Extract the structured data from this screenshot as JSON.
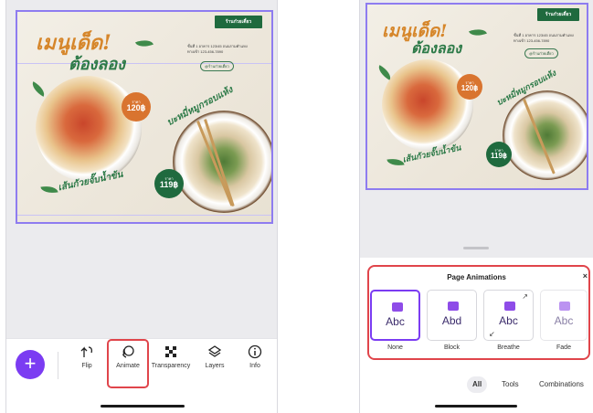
{
  "left_screen": {
    "design": {
      "brand": "ร้านก๋วยเตี๋ยว",
      "headline_line1": "เมนูเด็ด!",
      "headline_line2": "ต้องลอง",
      "info_line1": "ชั้นที่ 1 อาคาร 123/45 ถนนรามคำแหง",
      "info_line2": "ทางเข้า 123-456-7890",
      "info_pill": "@ร้านก๋วยเตี๋ยว",
      "price1_label": "ราคา",
      "price1": "120฿",
      "price2_label": "ราคา",
      "price2": "119฿",
      "caption_top": "บะหมี่หมูกรอบแห้ง",
      "caption_bottom": "เส้นกัวยจั๊บน้ำข้น"
    },
    "toolbar": {
      "add_label": "+",
      "tools": [
        {
          "label": "Flip",
          "icon": "flip-icon"
        },
        {
          "label": "Animate",
          "icon": "animate-icon"
        },
        {
          "label": "Transparency",
          "icon": "transparency-icon"
        },
        {
          "label": "Layers",
          "icon": "layers-icon"
        },
        {
          "label": "Info",
          "icon": "info-icon"
        }
      ],
      "selected_tool": "Animate"
    }
  },
  "right_screen": {
    "design": {
      "brand": "ร้านก๋วยเตี๋ยว",
      "headline_line1": "เมนูเด็ด!",
      "headline_line2": "ต้องลอง",
      "info_line1": "ชั้นที่ 1 อาคาร 123/45 ถนนรามคำแหง",
      "info_line2": "ทางเข้า 123-456-7890",
      "info_pill": "@ร้านก๋วยเตี๋ยว",
      "price1_label": "ราคา",
      "price1": "120฿",
      "price2_label": "ราคา",
      "price2": "119฿",
      "caption_top": "บะหมี่หมูกรอบแห้ง",
      "caption_bottom": "เส้นกัวยจั๊บน้ำข้น"
    },
    "panel": {
      "title": "Page Animations",
      "close_label": "×",
      "animations": [
        {
          "label": "None",
          "preview": "Abc",
          "selected": true
        },
        {
          "label": "Block",
          "preview": "Abd",
          "selected": false
        },
        {
          "label": "Breathe",
          "preview": "Abc",
          "selected": false
        },
        {
          "label": "Fade",
          "preview": "Abc",
          "selected": false
        }
      ],
      "filters": [
        {
          "label": "All",
          "active": true
        },
        {
          "label": "Tools",
          "active": false
        },
        {
          "label": "Combinations",
          "active": false
        }
      ]
    }
  },
  "colors": {
    "accent_purple": "#7b3cf2",
    "highlight_red": "#e0454b",
    "brand_green": "#1f6a3e",
    "price_orange": "#d9742f"
  }
}
